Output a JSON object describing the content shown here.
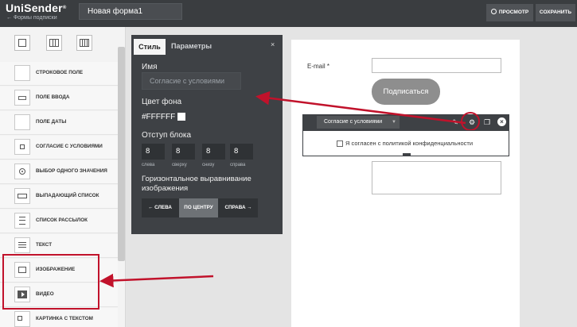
{
  "header": {
    "logo_text": "UniSender",
    "logo_reg": "®",
    "breadcrumb": "← Формы подписки",
    "form_name": "Новая форма1",
    "preview_label": "ПРОСМОТР",
    "save_label": "СОХРАНИТЬ"
  },
  "sidebar": {
    "layouts": [
      "one-column-icon",
      "three-column-icon",
      "four-column-icon"
    ],
    "items": [
      {
        "label": "СТРОКОВОЕ ПОЛЕ",
        "icon": "text-field-icon"
      },
      {
        "label": "ПОЛЕ ВВОДА",
        "icon": "input-field-icon"
      },
      {
        "label": "ПОЛЕ ДАТЫ",
        "icon": "date-field-icon"
      },
      {
        "label": "СОГЛАСИЕ С УСЛОВИЯМИ",
        "icon": "checkbox-icon"
      },
      {
        "label": "ВЫБОР ОДНОГО ЗНАЧЕНИЯ",
        "icon": "radio-icon"
      },
      {
        "label": "ВЫПАДАЮЩИЙ СПИСОК",
        "icon": "dropdown-icon"
      },
      {
        "label": "СПИСОК РАССЫЛОК",
        "icon": "list-icon"
      },
      {
        "label": "ТЕКСТ",
        "icon": "text-lines-icon"
      },
      {
        "label": "ИЗОБРАЖЕНИЕ",
        "icon": "image-icon"
      },
      {
        "label": "ВИДЕО",
        "icon": "video-icon"
      },
      {
        "label": "КАРТИНКА С ТЕКСТОМ",
        "icon": "image-text-icon"
      }
    ]
  },
  "panel": {
    "tab_style": "Стиль",
    "tab_params": "Параметры",
    "close": "×",
    "name_label": "Имя",
    "name_value": "Согласие с условиями",
    "bg_label": "Цвет фона",
    "bg_value": "#FFFFFF",
    "padding_label": "Отступ блока",
    "padding": [
      {
        "value": "8",
        "caption": "слева"
      },
      {
        "value": "8",
        "caption": "сверху"
      },
      {
        "value": "8",
        "caption": "снизу"
      },
      {
        "value": "8",
        "caption": "справа"
      }
    ],
    "align_label_1": "Горизонтальное выравнивание",
    "align_label_2": "изображения",
    "align_left": "← СЛЕВА",
    "align_center": "ПО ЦЕНТРУ",
    "align_right": "СПРАВА →"
  },
  "form": {
    "email_label": "E-mail *",
    "subscribe_label": "Подписаться",
    "block_select": "Согласие с условиями",
    "consent_text": "Я согласен с политикой конфиденциальности"
  },
  "colors": {
    "accent_red": "#c1122b",
    "dark_panel": "#3e4145",
    "topbar": "#3a3d40"
  }
}
